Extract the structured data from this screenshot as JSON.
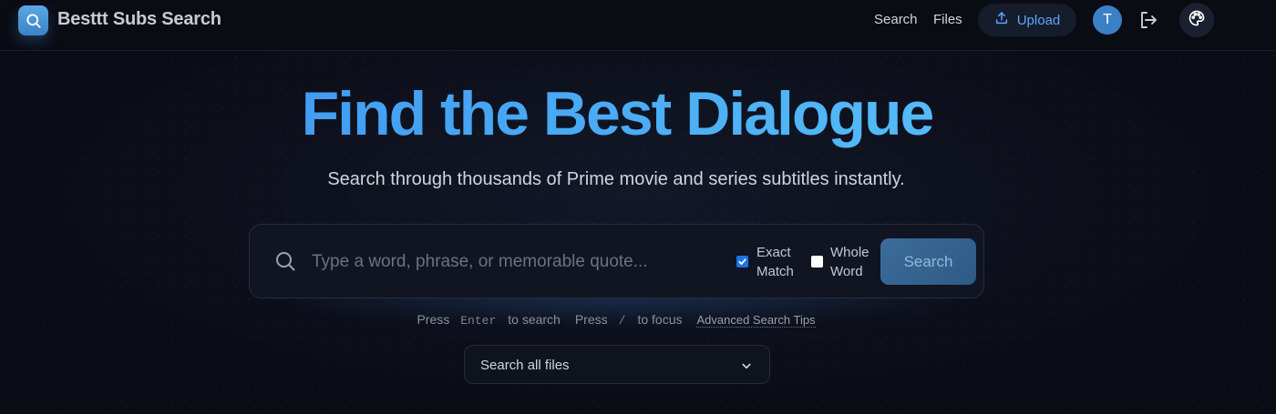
{
  "header": {
    "brand": "Besttt Subs Search",
    "nav": {
      "search": "Search",
      "files": "Files"
    },
    "upload_label": "Upload",
    "avatar_initial": "T",
    "accent": "#60a5fa"
  },
  "hero": {
    "title": "Find the Best Dialogue",
    "subtitle": "Search through thousands of Prime movie and series subtitles instantly."
  },
  "search": {
    "placeholder": "Type a word, phrase, or memorable quote...",
    "value": "",
    "options": {
      "exact_match": {
        "line1": "Exact",
        "line2": "Match",
        "checked": true
      },
      "whole_word": {
        "line1": "Whole",
        "line2": "Word",
        "checked": false
      }
    },
    "button_label": "Search"
  },
  "hints": {
    "press1": "Press",
    "key_enter": "Enter",
    "to_search": "to search",
    "press2": "Press",
    "key_slash": "/",
    "to_focus": "to focus",
    "tips_link": "Advanced Search Tips"
  },
  "file_filter": {
    "selected": "Search all files"
  },
  "icons": {
    "logo": "search-icon",
    "upload": "upload-icon",
    "logout": "logout-icon",
    "theme": "palette-icon",
    "search": "search-icon",
    "select": "chevron-down-icon"
  }
}
